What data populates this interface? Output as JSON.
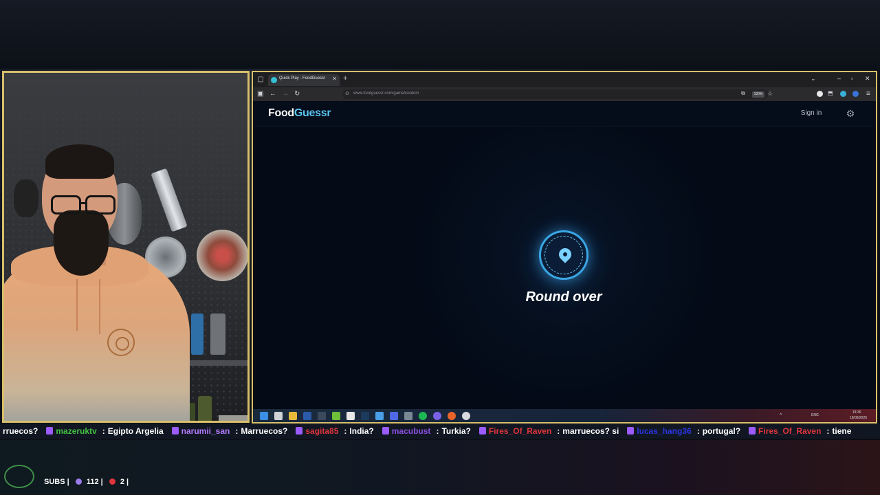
{
  "browser": {
    "tab_title": "Quick Play - FoodGuessr",
    "url": "www.foodguessr.com/game/random",
    "zoom": "120%"
  },
  "site": {
    "brand_part1": "Food",
    "brand_part2": "Guessr",
    "sign_in": "Sign in",
    "status_text": "Round over"
  },
  "taskbar": {
    "language": "ENG",
    "time": "18:36",
    "date": "18/08/2026"
  },
  "chat": [
    {
      "user": "",
      "text": "rruecos?",
      "color": "#ffffff"
    },
    {
      "user": "mazeruktv",
      "text": "Egipto Argelia",
      "color": "#43c143"
    },
    {
      "user": "narumii_san",
      "text": "Marruecos?",
      "color": "#b57bff"
    },
    {
      "user": "sagita85",
      "text": "India?",
      "color": "#e0353c"
    },
    {
      "user": "macubust",
      "text": "Turkia?",
      "color": "#8a4fe0"
    },
    {
      "user": "Fires_Of_Raven",
      "text": "marruecos? si",
      "color": "#e0353c"
    },
    {
      "user": "lucas_hang36",
      "text": "portugal?",
      "color": "#2b35e0"
    },
    {
      "user": "Fires_Of_Raven",
      "text": "tiene",
      "color": "#e0353c"
    }
  ],
  "stream_stats": {
    "subs_label": "SUBS |",
    "count1": "112 |",
    "count2": "2 |"
  },
  "colors": {
    "accent": "#59c4ef",
    "frame": "#d8c06a",
    "twitch": "#9c5bff"
  }
}
